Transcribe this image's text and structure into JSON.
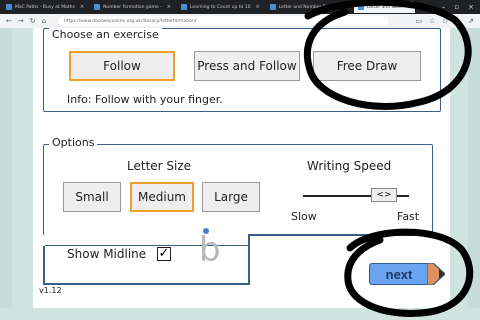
{
  "browser": {
    "tabs": [
      {
        "label": "MaC Paths - Busy at Maths",
        "active": false
      },
      {
        "label": "Number formation game - ",
        "active": false
      },
      {
        "label": "Learning to Count up to 10",
        "active": false
      },
      {
        "label": "Letter and Number Format",
        "active": false
      },
      {
        "label": "Letter and Num",
        "active": true
      }
    ],
    "url": "https://www.doorwayonline.org.uk/literacy/letterformation/"
  },
  "exercise": {
    "title": "Choose an exercise",
    "buttons": [
      "Follow",
      "Press and Follow",
      "Free Draw"
    ],
    "selected": "Follow",
    "info": "Info: Follow with your finger."
  },
  "options": {
    "title": "Options",
    "letter_size_label": "Letter Size",
    "sizes": [
      "Small",
      "Medium",
      "Large"
    ],
    "selected_size": "Medium",
    "speed_label": "Writing Speed",
    "slow": "Slow",
    "fast": "Fast",
    "thumb": "<>",
    "speed_level": 0.85,
    "midline_label": "Show Midline",
    "midline_checked": "✓",
    "preview_letter": "b"
  },
  "next_label": "next",
  "version": "v1.12"
}
